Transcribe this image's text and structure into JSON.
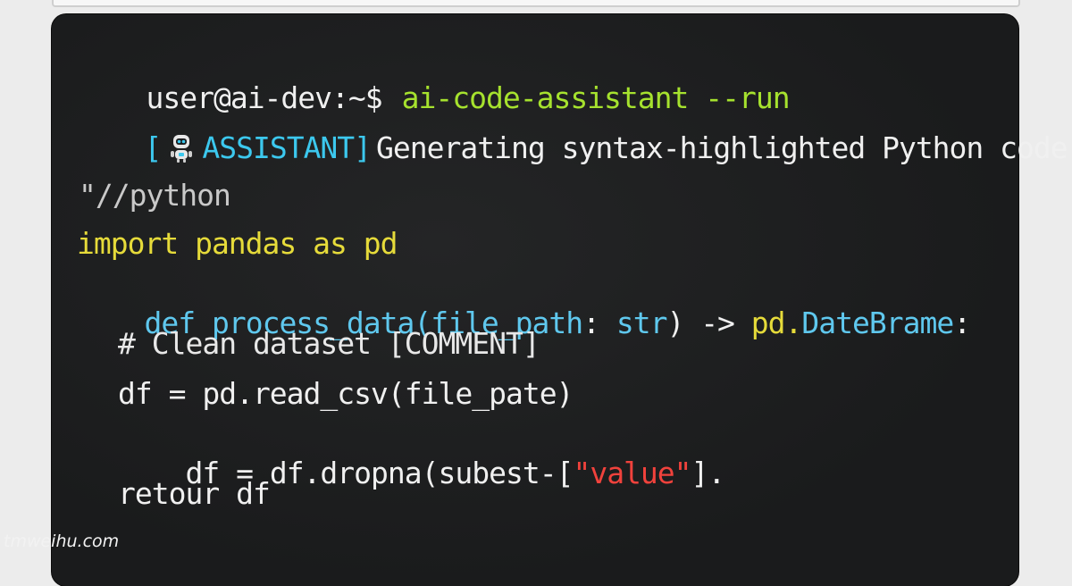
{
  "terminal": {
    "prompt": "user@ai-dev:~$",
    "command": "ai-code-assistant --run",
    "status": {
      "open_bracket": "[",
      "robot_icon": "robot-icon",
      "tag": "ASSISTANT]",
      "message": "Generating syntax-highlighted Python code..."
    }
  },
  "code": {
    "fence": "\"//python",
    "line1": "import pandas as pd",
    "line2_def": "def ",
    "line2_name": "process_data",
    "line2_args": "(file_path",
    "line2_colon": ": ",
    "line2_type": "str",
    "line2_close": ") ",
    "line2_arrow": "-> ",
    "line2_ret_pd": "pd.",
    "line2_ret_cls": "DateBrame",
    "line2_end": ":",
    "line3": "# Clean dataset [COMMENT]",
    "line4": "df = pd.read_csv(file_pate)",
    "line5_pre": "df = df.dropna(subest-[",
    "line5_str": "\"value\"",
    "line5_post": "].",
    "line6": "retour df"
  },
  "colors": {
    "command": "#a6e22e",
    "assistant": "#3cc8ee",
    "keyword_yellow": "#e6db3a",
    "keyword_blue": "#5fc8ee",
    "string": "#f0423c",
    "background": "#1a1b1c"
  },
  "watermark": "tmweihu.com"
}
